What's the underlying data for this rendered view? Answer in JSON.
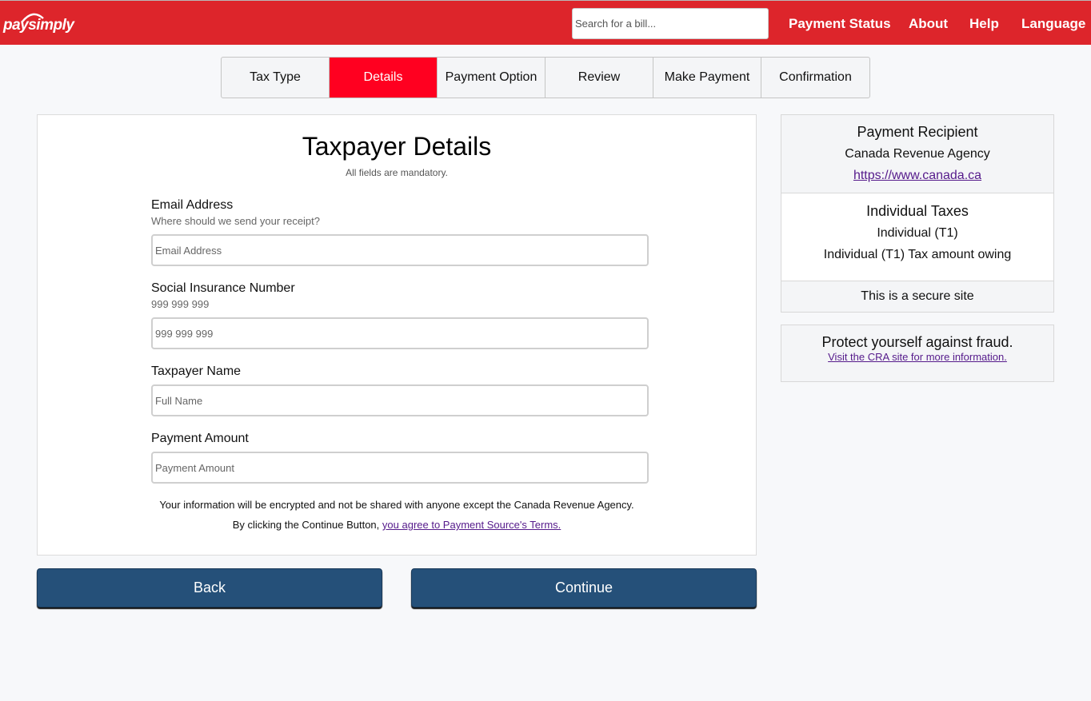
{
  "header": {
    "logo": "paysimply",
    "search_placeholder": "Search for a bill...",
    "nav": [
      "Payment Status",
      "About",
      "Help",
      "Language"
    ]
  },
  "steps": [
    {
      "label": "Tax Type",
      "active": false
    },
    {
      "label": "Details",
      "active": true
    },
    {
      "label": "Payment Option",
      "active": false
    },
    {
      "label": "Review",
      "active": false
    },
    {
      "label": "Make Payment",
      "active": false
    },
    {
      "label": "Confirmation",
      "active": false
    }
  ],
  "form": {
    "title": "Taxpayer Details",
    "subtitle": "All fields are mandatory.",
    "email": {
      "label": "Email Address",
      "hint": "Where should we send your receipt?",
      "placeholder": "Email Address",
      "value": ""
    },
    "sin": {
      "label": "Social Insurance Number",
      "hint": "999 999 999",
      "placeholder": "999 999 999",
      "value": ""
    },
    "name": {
      "label": "Taxpayer Name",
      "placeholder": "Full Name",
      "value": ""
    },
    "amount": {
      "label": "Payment Amount",
      "placeholder": "Payment Amount",
      "value": ""
    },
    "privacy_note": "Your information will be encrypted and not be shared with anyone except the Canada Revenue Agency.",
    "terms_prefix": "By clicking the Continue Button,",
    "terms_link": "you agree to Payment Source's Terms."
  },
  "buttons": {
    "back": "Back",
    "continue": "Continue"
  },
  "sidebar": {
    "recipient_title": "Payment Recipient",
    "recipient_name": "Canada Revenue Agency",
    "recipient_url": "https://www.canada.ca",
    "tax_title": "Individual Taxes",
    "tax_type": "Individual (T1)",
    "tax_desc": "Individual (T1) Tax amount owing",
    "secure_text": "This is a secure site",
    "fraud_title": "Protect yourself against fraud.",
    "fraud_link": "Visit the CRA site for more information."
  },
  "colors": {
    "header": "#dd252b",
    "active_step": "#ff0020",
    "button": "#255079",
    "link": "#551a8b"
  }
}
